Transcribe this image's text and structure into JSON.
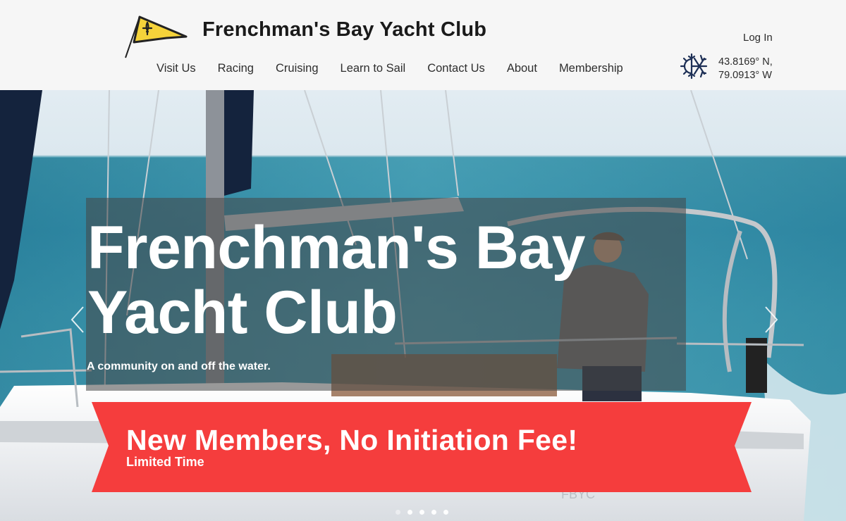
{
  "header": {
    "title": "Frenchman's Bay Yacht Club",
    "login_label": "Log In",
    "logo_icon": "burgee-fleur-de-lis-icon",
    "nav": [
      {
        "label": "Visit Us"
      },
      {
        "label": "Racing"
      },
      {
        "label": "Cruising"
      },
      {
        "label": "Learn to Sail"
      },
      {
        "label": "Contact Us"
      },
      {
        "label": "About"
      },
      {
        "label": "Membership"
      }
    ],
    "weather_icon": "sun-snowflake-icon",
    "coords": {
      "lat": "43.8169° N,",
      "lon": "79.0913° W"
    }
  },
  "hero": {
    "title_line1": "Frenchman's Bay",
    "title_line2": "Yacht Club",
    "subtitle": "A community on and off the water.",
    "promo_title": "New Members, No Initiation Fee!",
    "promo_subtitle": "Limited Time",
    "slide_count": 5,
    "active_slide": 2
  },
  "colors": {
    "banner": "#f53d3d",
    "header_bg": "#f6f6f6",
    "burgee_yellow": "#f5d33a",
    "icon_navy": "#1d2f55"
  }
}
